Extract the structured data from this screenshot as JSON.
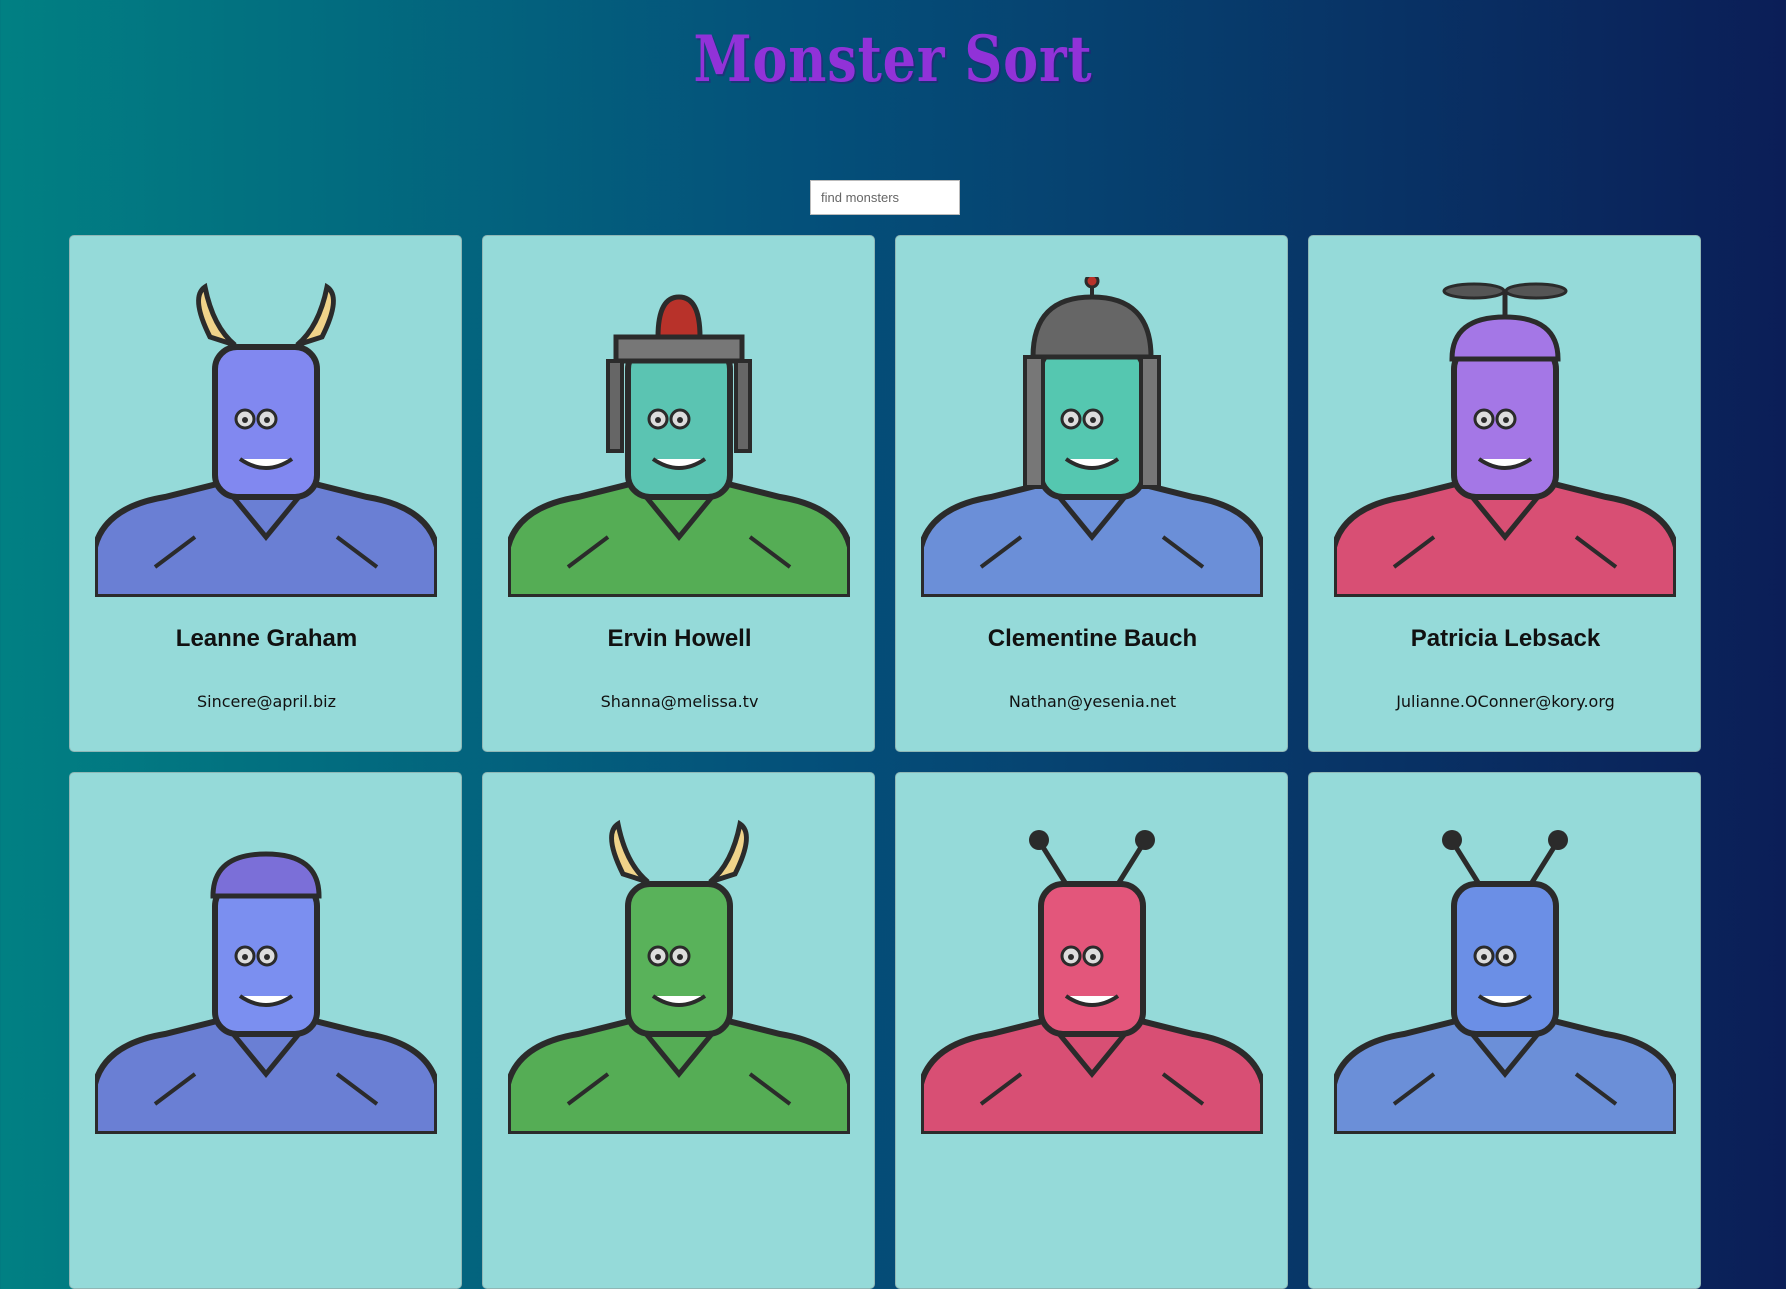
{
  "header": {
    "title": "Monster Sort"
  },
  "search": {
    "placeholder": "find monsters",
    "value": ""
  },
  "monsters": [
    {
      "name": "Leanne Graham",
      "email": "Sincere@april.biz",
      "avatar": "horned-purple-monster-icon",
      "skin": "#8188f0",
      "body": "#6a7fd4"
    },
    {
      "name": "Ervin Howell",
      "email": "Shanna@melissa.tv",
      "avatar": "siren-helmet-robot-icon",
      "skin": "#5bc4b2",
      "body": "#55ad55"
    },
    {
      "name": "Clementine Bauch",
      "email": "Nathan@yesenia.net",
      "avatar": "antenna-helmet-robot-icon",
      "skin": "#55c7b0",
      "body": "#6b8fd8"
    },
    {
      "name": "Patricia Lebsack",
      "email": "Julianne.OConner@kory.org",
      "avatar": "propeller-helmet-robot-icon",
      "skin": "#a477e6",
      "body": "#d84f74"
    },
    {
      "name": "",
      "email": "",
      "avatar": "helmet-monster-icon",
      "skin": "#7b8ff0",
      "body": "#6a7fd4"
    },
    {
      "name": "",
      "email": "",
      "avatar": "horned-green-monster-icon",
      "skin": "#59b25a",
      "body": "#55ad55"
    },
    {
      "name": "",
      "email": "",
      "avatar": "antenna-pink-monster-icon",
      "skin": "#e3567b",
      "body": "#d84f74"
    },
    {
      "name": "",
      "email": "",
      "avatar": "antenna-blue-monster-icon",
      "skin": "#6b8fe6",
      "body": "#6b8fd8"
    }
  ]
}
